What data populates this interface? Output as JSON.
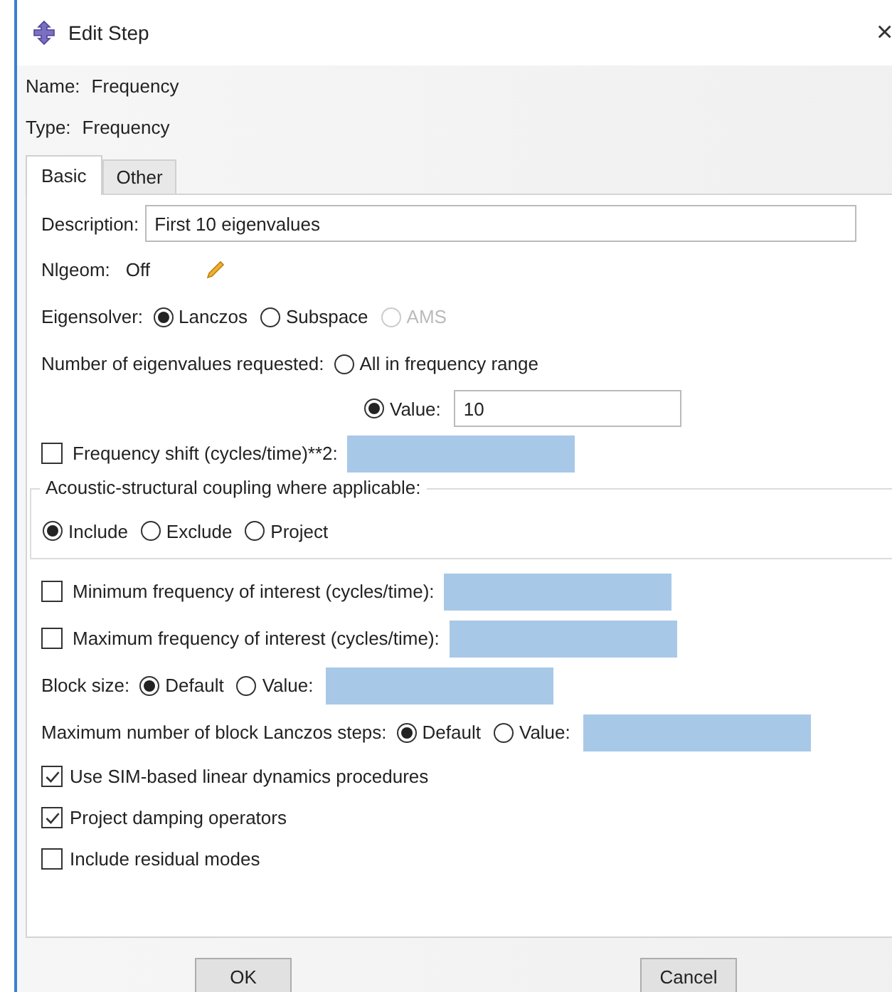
{
  "window": {
    "title": "Edit Step",
    "close": "×"
  },
  "name": {
    "label": "Name:",
    "value": "Frequency"
  },
  "type": {
    "label": "Type:",
    "value": "Frequency"
  },
  "tabs": [
    {
      "label": "Basic",
      "selected": true
    },
    {
      "label": "Other",
      "selected": false
    }
  ],
  "description": {
    "label": "Description:",
    "value": "First 10 eigenvalues"
  },
  "nlgeom": {
    "label": "Nlgeom:",
    "value": "Off"
  },
  "eigensolver": {
    "label": "Eigensolver:",
    "options": [
      {
        "label": "Lanczos",
        "selected": true,
        "disabled": false
      },
      {
        "label": "Subspace",
        "selected": false,
        "disabled": false
      },
      {
        "label": "AMS",
        "selected": false,
        "disabled": true
      }
    ]
  },
  "eigenvalues": {
    "label": "Number of eigenvalues requested:",
    "all": {
      "label": "All in frequency range",
      "selected": false
    },
    "value": {
      "label": "Value:",
      "selected": true,
      "value": "10"
    }
  },
  "frequency_shift": {
    "label": "Frequency shift (cycles/time)**2:",
    "checked": false
  },
  "coupling": {
    "title": "Acoustic-structural coupling where applicable:",
    "options": [
      {
        "label": "Include",
        "selected": true
      },
      {
        "label": "Exclude",
        "selected": false
      },
      {
        "label": "Project",
        "selected": false
      }
    ]
  },
  "frequency_limits": [
    {
      "label": "Minimum frequency of interest (cycles/time):",
      "checked": false
    },
    {
      "label": "Maximum frequency of interest (cycles/time):",
      "checked": false
    }
  ],
  "block_settings": [
    {
      "label": "Block size:",
      "default": {
        "label": "Default",
        "selected": true
      },
      "value": {
        "label": "Value:",
        "selected": false
      }
    },
    {
      "label": "Maximum number of block Lanczos steps:",
      "default": {
        "label": "Default",
        "selected": true
      },
      "value": {
        "label": "Value:",
        "selected": false
      }
    }
  ],
  "options": [
    {
      "label": "Use SIM-based linear dynamics procedures",
      "checked": true
    },
    {
      "label": "Project damping operators",
      "checked": true
    },
    {
      "label": "Include residual modes",
      "checked": false
    }
  ],
  "buttons": [
    "OK",
    "Cancel"
  ]
}
